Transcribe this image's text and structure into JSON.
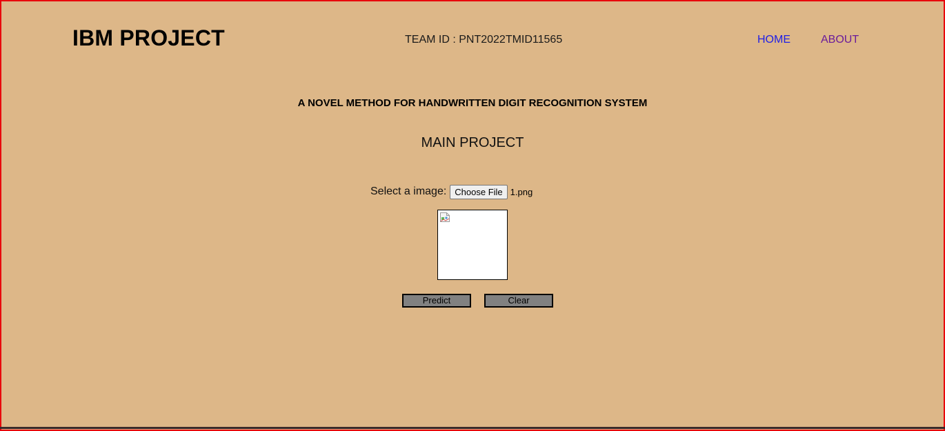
{
  "header": {
    "brand": "IBM PROJECT",
    "team_id": "TEAM ID : PNT2022TMID11565",
    "nav": {
      "home": "HOME",
      "about": "ABOUT"
    }
  },
  "main": {
    "headline": "A NOVEL METHOD FOR HANDWRITTEN DIGIT RECOGNITION SYSTEM",
    "subhead": "MAIN PROJECT",
    "upload": {
      "label": "Select a image:",
      "button_label": "Choose File",
      "file_name": "1.png"
    },
    "preview": {
      "icon": "broken-image-icon"
    },
    "buttons": {
      "predict": "Predict",
      "clear": "Clear"
    }
  },
  "colors": {
    "background": "#ddb788",
    "frame_border": "#e8000b",
    "nav_home": "#1e1ee6",
    "nav_about": "#6a1b9a",
    "button_bg": "#818181"
  }
}
